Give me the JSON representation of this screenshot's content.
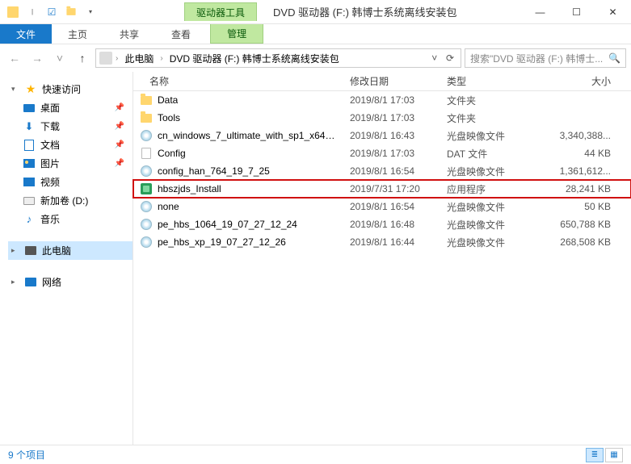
{
  "titlebar": {
    "context_tab": "驱动器工具",
    "title": "DVD 驱动器 (F:) 韩博士系统离线安装包"
  },
  "win": {
    "min": "—",
    "max": "☐",
    "close": "✕"
  },
  "ribbon": {
    "file": "文件",
    "home": "主页",
    "share": "共享",
    "view": "查看",
    "manage": "管理"
  },
  "nav": {
    "back": "←",
    "forward": "→",
    "recent": "˅",
    "up": "↑",
    "refresh": "⟳"
  },
  "breadcrumb": {
    "items": [
      "此电脑",
      "DVD 驱动器 (F:) 韩博士系统离线安装包"
    ]
  },
  "search": {
    "placeholder": "搜索\"DVD 驱动器 (F:) 韩博士...",
    "icon": "🔍"
  },
  "sidebar": {
    "quick_access": "快速访问",
    "desktop": "桌面",
    "downloads": "下载",
    "documents": "文档",
    "pictures": "图片",
    "videos": "视频",
    "new_volume": "新加卷 (D:)",
    "music": "音乐",
    "this_pc": "此电脑",
    "network": "网络"
  },
  "columns": {
    "name": "名称",
    "date": "修改日期",
    "type": "类型",
    "size": "大小"
  },
  "files": [
    {
      "icon": "folder",
      "name": "Data",
      "date": "2019/8/1 17:03",
      "type": "文件夹",
      "size": ""
    },
    {
      "icon": "folder",
      "name": "Tools",
      "date": "2019/8/1 17:03",
      "type": "文件夹",
      "size": ""
    },
    {
      "icon": "disc",
      "name": "cn_windows_7_ultimate_with_sp1_x64_...",
      "date": "2019/8/1 16:43",
      "type": "光盘映像文件",
      "size": "3,340,388..."
    },
    {
      "icon": "file",
      "name": "Config",
      "date": "2019/8/1 17:03",
      "type": "DAT 文件",
      "size": "44 KB"
    },
    {
      "icon": "disc",
      "name": "config_han_764_19_7_25",
      "date": "2019/8/1 16:54",
      "type": "光盘映像文件",
      "size": "1,361,612..."
    },
    {
      "icon": "app",
      "name": "hbszjds_Install",
      "date": "2019/7/31 17:20",
      "type": "应用程序",
      "size": "28,241 KB",
      "highlight": true
    },
    {
      "icon": "disc",
      "name": "none",
      "date": "2019/8/1 16:54",
      "type": "光盘映像文件",
      "size": "50 KB"
    },
    {
      "icon": "disc",
      "name": "pe_hbs_1064_19_07_27_12_24",
      "date": "2019/8/1 16:48",
      "type": "光盘映像文件",
      "size": "650,788 KB"
    },
    {
      "icon": "disc",
      "name": "pe_hbs_xp_19_07_27_12_26",
      "date": "2019/8/1 16:44",
      "type": "光盘映像文件",
      "size": "268,508 KB"
    }
  ],
  "status": {
    "count": "9 个项目"
  }
}
